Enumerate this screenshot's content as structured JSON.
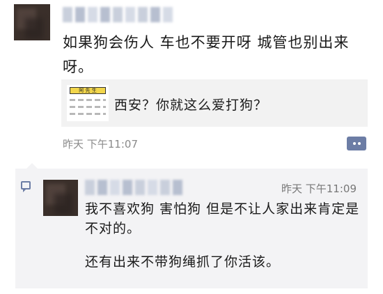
{
  "post": {
    "text": "如果狗会伤人  车也不要开呀  城管也别出来呀。",
    "link_card": {
      "thumb_label": "阿 先 生",
      "title": "西安？你就这么爱打狗？"
    },
    "time": "昨天 下午11:07"
  },
  "comment": {
    "time": "昨天 下午11:09",
    "lines": [
      "我不喜欢狗  害怕狗  但是不让人家出来肯定是不对的。",
      "还有出来不带狗绳抓了你活该。"
    ]
  },
  "colors": {
    "accent": "#6c7da5",
    "comment_bg": "#f3f3f5",
    "card_bg": "#f2f2f2",
    "time_gray": "#8a8a8a"
  }
}
